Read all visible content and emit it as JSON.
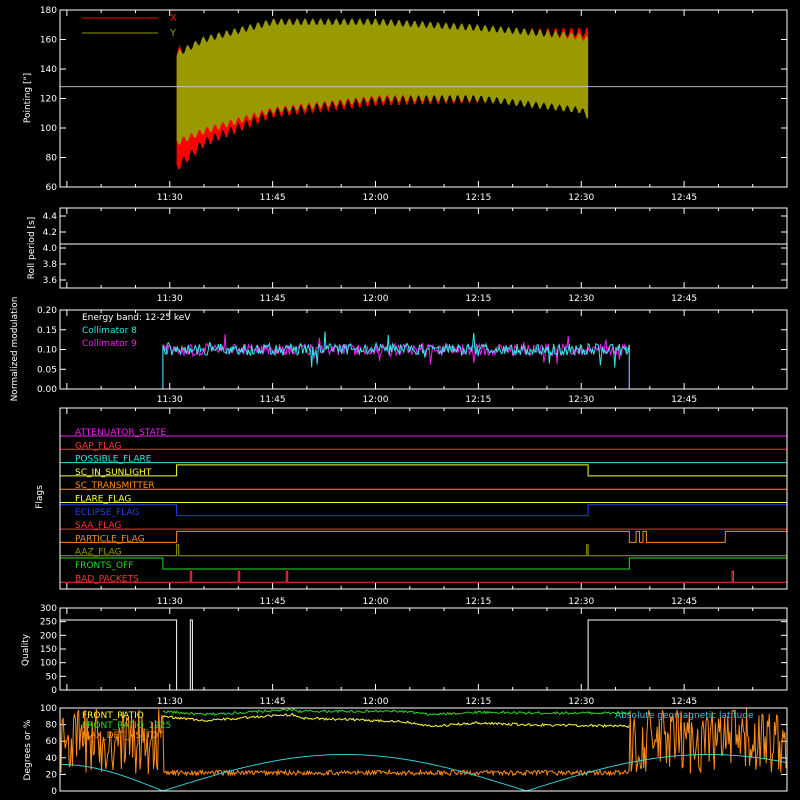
{
  "colors": {
    "background": "#000000",
    "axis": "#ffffff",
    "x_pointing": "#ff0000",
    "y_pointing": "#999900",
    "collimator_8": "#33e6e6",
    "collimator_9": "#ee22ee",
    "front_ratio": "#ffff33",
    "front_ratio_1225": "#22dd22",
    "max_det_vs_tot": "#ff8c1a",
    "geomagnetic": "#33cccc"
  },
  "time_ticks": [
    "11:30",
    "11:45",
    "12:00",
    "12:15",
    "12:30",
    "12:45"
  ],
  "chart_data": [
    {
      "type": "area",
      "name": "pointing",
      "ylabel": "Pointing [\"]",
      "ylim": [
        60,
        180
      ],
      "yticks": [
        "60",
        "80",
        "100",
        "120",
        "140",
        "160",
        "180"
      ],
      "xlim": [
        "11:14",
        "13:00"
      ],
      "legend": [
        "X",
        "Y"
      ],
      "reference_line": 128,
      "series": [
        {
          "name": "X",
          "x": [
            "11:31",
            "11:35",
            "11:45",
            "12:00",
            "12:15",
            "12:30",
            "12:31"
          ],
          "upper": [
            152,
            155,
            162,
            165,
            164,
            165,
            165
          ],
          "lower": [
            73,
            90,
            110,
            118,
            120,
            118,
            110
          ]
        },
        {
          "name": "Y",
          "x": [
            "11:31",
            "11:35",
            "11:45",
            "12:00",
            "12:15",
            "12:30",
            "12:31"
          ],
          "upper": [
            150,
            160,
            172,
            172,
            168,
            162,
            160
          ],
          "lower": [
            90,
            98,
            112,
            120,
            120,
            112,
            108
          ]
        }
      ]
    },
    {
      "type": "line",
      "name": "roll-period",
      "ylabel": "Roll period [s]",
      "ylim": [
        3.5,
        4.5
      ],
      "yticks": [
        "3.6",
        "3.8",
        "4.0",
        "4.2",
        "4.4"
      ],
      "series": [
        {
          "x": [
            "11:14",
            "13:00"
          ],
          "values": [
            4.05,
            4.05
          ]
        }
      ]
    },
    {
      "type": "line",
      "name": "modulation",
      "ylabel": "Normalized modulation",
      "ylim": [
        0,
        0.2
      ],
      "yticks": [
        "0.00",
        "0.05",
        "0.10",
        "0.15",
        "0.20"
      ],
      "annotation": "Energy band: 12-25 keV",
      "legend": [
        "Collimator 8",
        "Collimator 9"
      ],
      "active_start": "11:29",
      "active_end": "12:37",
      "mean": 0.1
    },
    {
      "type": "line",
      "name": "flags",
      "ylabel": "Flags",
      "flags": [
        {
          "label": "ATTENUATOR_STATE",
          "color": "#ee22ee",
          "high": []
        },
        {
          "label": "GAP_FLAG",
          "color": "#ff3333",
          "high": []
        },
        {
          "label": "POSSIBLE_FLARE",
          "color": "#33e6e6",
          "high": []
        },
        {
          "label": "SC_IN_SUNLIGHT",
          "color": "#ffff33",
          "high": [
            [
              "11:31",
              "12:31"
            ]
          ]
        },
        {
          "label": "SC_TRANSMITTER",
          "color": "#ff8c1a",
          "high": []
        },
        {
          "label": "FLARE_FLAG",
          "color": "#ffff33",
          "high": []
        },
        {
          "label": "ECLIPSE_FLAG",
          "color": "#1f3cff",
          "high": [
            [
              "11:14",
              "11:31"
            ],
            [
              "12:31",
              "13:00"
            ]
          ]
        },
        {
          "label": "SAA_FLAG",
          "color": "#ff3333",
          "high": []
        },
        {
          "label": "PARTICLE_FLAG",
          "color": "#ff8c1a",
          "high": [
            [
              "11:31",
              "12:37"
            ],
            [
              "12:38",
              "12:38.5"
            ],
            [
              "12:39",
              "12:39.5"
            ],
            [
              "12:51",
              "13:00"
            ]
          ]
        },
        {
          "label": "AAZ_FLAG",
          "color": "#999900",
          "high": [
            [
              "11:31",
              "11:31.3"
            ],
            [
              "12:30.8",
              "12:31"
            ]
          ]
        },
        {
          "label": "FRONTS_OFF",
          "color": "#22dd22",
          "high": [
            [
              "11:14",
              "11:29"
            ],
            [
              "12:37",
              "13:00"
            ]
          ]
        },
        {
          "label": "BAD_PACKETS",
          "color": "#ff3333",
          "high": [
            [
              "11:33",
              "11:33.2"
            ],
            [
              "11:40",
              "11:40.2"
            ],
            [
              "11:47",
              "11:47.2"
            ],
            [
              "12:52",
              "12:52.2"
            ]
          ]
        }
      ]
    },
    {
      "type": "line",
      "name": "quality",
      "ylabel": "Quality",
      "ylim": [
        0,
        300
      ],
      "yticks": [
        "0",
        "50",
        "100",
        "150",
        "200",
        "250",
        "300"
      ],
      "series": [
        {
          "x": [
            "11:14",
            "11:31",
            "11:31",
            "11:33",
            "11:33",
            "11:33.3",
            "11:33.3",
            "12:31",
            "12:31",
            "13:00"
          ],
          "values": [
            256,
            256,
            0,
            0,
            256,
            256,
            0,
            0,
            256,
            256
          ]
        }
      ]
    },
    {
      "type": "line",
      "name": "ratios",
      "ylabel": "Degrees or %",
      "ylim": [
        0,
        100
      ],
      "yticks": [
        "0",
        "20",
        "40",
        "60",
        "80",
        "100"
      ],
      "legend": [
        "FRONT_RATIO",
        "FRONT_RATIO_1225",
        "MAX_DET_VS_TOT"
      ],
      "annotation": "Absolute geomagnetic latitude",
      "series": [
        {
          "name": "FRONT_RATIO",
          "x": [
            "11:29",
            "11:35",
            "11:48",
            "11:49",
            "12:04",
            "12:08",
            "12:15",
            "12:22",
            "12:37"
          ],
          "values": [
            90,
            85,
            92,
            88,
            84,
            78,
            82,
            80,
            78
          ]
        },
        {
          "name": "FRONT_RATIO_1225",
          "x": [
            "11:29",
            "11:35",
            "11:48",
            "11:49",
            "12:04",
            "12:08",
            "12:15",
            "12:22",
            "12:37"
          ],
          "values": [
            96,
            92,
            98,
            96,
            96,
            92,
            95,
            94,
            94
          ]
        },
        {
          "name": "Absolute geomagnetic latitude",
          "x": [
            "11:14",
            "11:29",
            "11:55",
            "12:22",
            "12:48",
            "13:00"
          ],
          "values": [
            32,
            0,
            44,
            0,
            44,
            30
          ]
        }
      ]
    }
  ]
}
